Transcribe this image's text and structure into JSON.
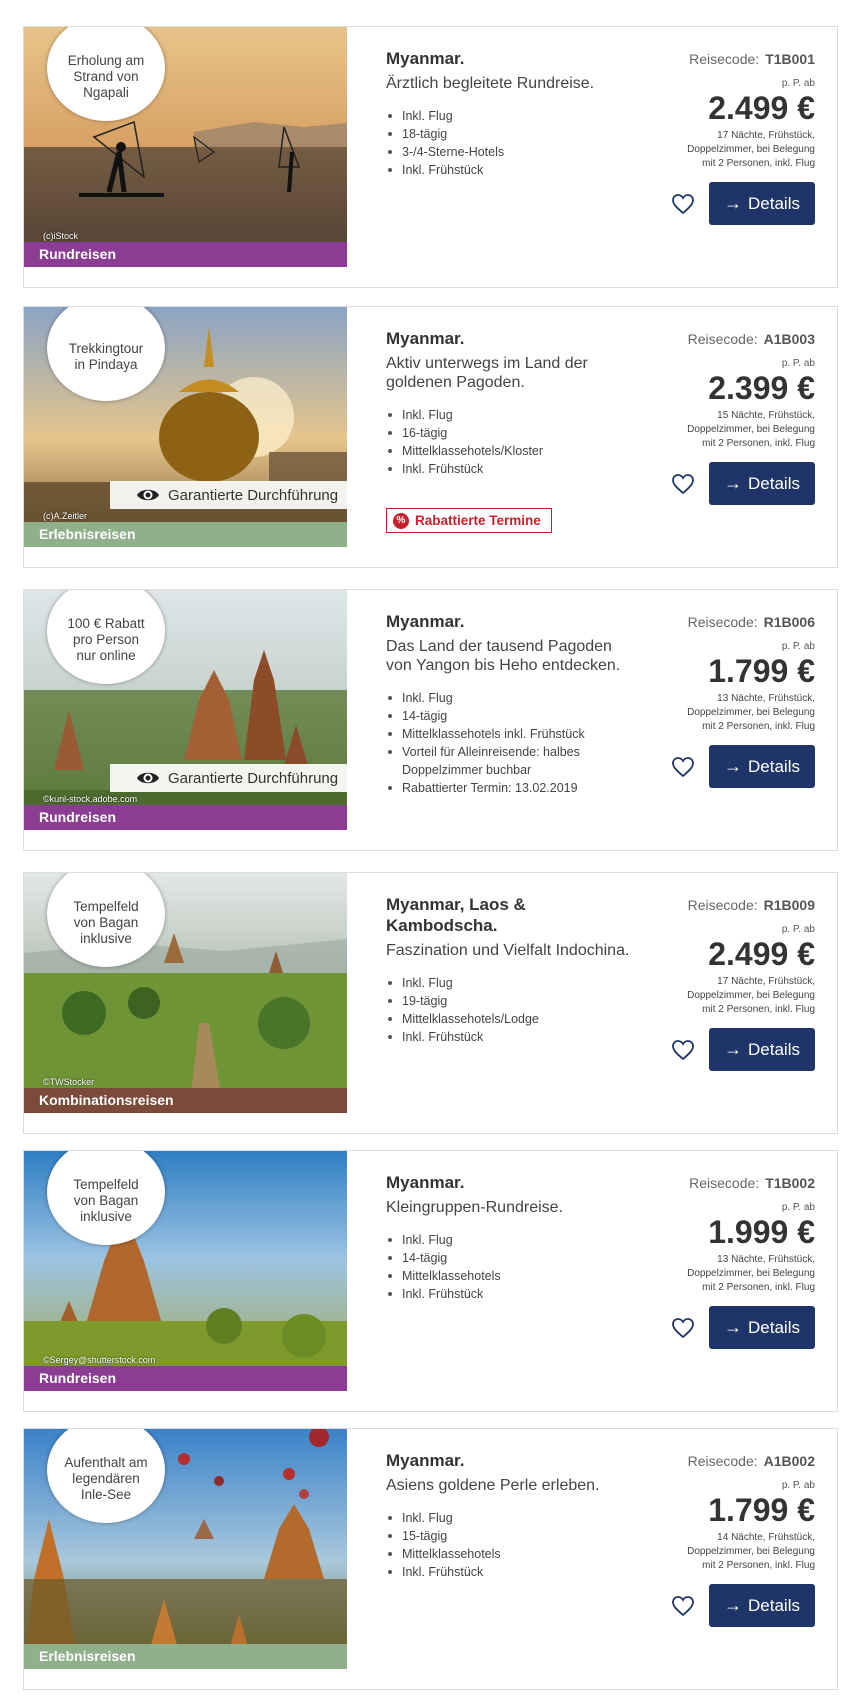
{
  "colors": {
    "button": "#1f3569",
    "rundreisen": "#8b3d93",
    "erlebnisreisen": "#8fb08a",
    "kombinationsreisen": "#7b4a3a",
    "discount": "#c8202a"
  },
  "icons": {
    "eye": "eye-icon",
    "heart": "heart-outline-icon",
    "arrow": "arrow-right-icon",
    "percent": "percent-badge-icon"
  },
  "trips": [
    {
      "badge": "Erholung am\nStrand von\nNgapali",
      "credit": "(c)iStock",
      "category": "Rundreisen",
      "title": "Myanmar.",
      "subtitle": "Ärztlich begleitete Rundreise.",
      "features": [
        "Inkl. Flug",
        "18-tägig",
        "3-/4-Sterne-Hotels",
        "Inkl. Frühstück"
      ],
      "code_label": "Reisecode:",
      "code": "T1B001",
      "pp_label": "p. P. ab",
      "price": "2.499 €",
      "note": "17 Nächte, Frühstück,\nDoppelzimmer, bei Belegung\nmit 2 Personen, inkl. Flug",
      "details_label": "Details"
    },
    {
      "badge": "Trekkingtour\nin Pindaya",
      "credit": "(c)A.Zeitler",
      "guarantee": "Garantierte Durchführung",
      "category": "Erlebnisreisen",
      "title": "Myanmar.",
      "subtitle": "Aktiv unterwegs im Land der goldenen Pagoden.",
      "features": [
        "Inkl. Flug",
        "16-tägig",
        "Mittelklassehotels/Kloster",
        "Inkl. Frühstück"
      ],
      "discount_label": "Rabattierte Termine",
      "code_label": "Reisecode:",
      "code": "A1B003",
      "pp_label": "p. P. ab",
      "price": "2.399 €",
      "note": "15 Nächte, Frühstück,\nDoppelzimmer, bei Belegung\nmit 2 Personen, inkl. Flug",
      "details_label": "Details"
    },
    {
      "badge": "100 € Rabatt\npro Person\nnur online",
      "credit": "©kunl-stock.adobe.com",
      "guarantee": "Garantierte Durchführung",
      "category": "Rundreisen",
      "title": "Myanmar.",
      "subtitle": "Das Land der tausend Pagoden von Yangon bis Heho entdecken.",
      "features": [
        "Inkl. Flug",
        "14-tägig",
        "Mittelklassehotels inkl. Frühstück",
        "Vorteil für Alleinreisende: halbes Doppelzimmer buchbar",
        "Rabattierter Termin: 13.02.2019"
      ],
      "code_label": "Reisecode:",
      "code": "R1B006",
      "pp_label": "p. P. ab",
      "price": "1.799 €",
      "note": "13 Nächte, Frühstück,\nDoppelzimmer, bei Belegung\nmit 2 Personen, inkl. Flug",
      "details_label": "Details"
    },
    {
      "badge": "Tempelfeld\nvon Bagan\ninklusive",
      "credit": "©TWStocker",
      "category": "Kombinationsreisen",
      "title": "Myanmar, Laos & Kambodscha.",
      "subtitle": "Faszination und Vielfalt Indochina.",
      "features": [
        "Inkl. Flug",
        "19-tägig",
        "Mittelklassehotels/Lodge",
        "Inkl. Frühstück"
      ],
      "code_label": "Reisecode:",
      "code": "R1B009",
      "pp_label": "p. P. ab",
      "price": "2.499 €",
      "note": "17 Nächte, Frühstück,\nDoppelzimmer, bei Belegung\nmit 2 Personen, inkl. Flug",
      "details_label": "Details"
    },
    {
      "badge": "Tempelfeld\nvon Bagan\ninklusive",
      "credit": "©Sergey@shutterstock.com",
      "category": "Rundreisen",
      "title": "Myanmar.",
      "subtitle": "Kleingruppen-Rundreise.",
      "features": [
        "Inkl. Flug",
        "14-tägig",
        "Mittelklassehotels",
        "Inkl. Frühstück"
      ],
      "code_label": "Reisecode:",
      "code": "T1B002",
      "pp_label": "p. P. ab",
      "price": "1.999 €",
      "note": "13 Nächte, Frühstück,\nDoppelzimmer, bei Belegung\nmit 2 Personen, inkl. Flug",
      "details_label": "Details"
    },
    {
      "badge": "Aufenthalt am\nlegendären\nInle-See",
      "category": "Erlebnisreisen",
      "title": "Myanmar.",
      "subtitle": "Asiens goldene Perle erleben.",
      "features": [
        "Inkl. Flug",
        "15-tägig",
        "Mittelklassehotels",
        "Inkl. Frühstück"
      ],
      "code_label": "Reisecode:",
      "code": "A1B002",
      "pp_label": "p. P. ab",
      "price": "1.799 €",
      "note": "14 Nächte, Frühstück,\nDoppelzimmer, bei Belegung\nmit 2 Personen, inkl. Flug",
      "details_label": "Details"
    }
  ]
}
